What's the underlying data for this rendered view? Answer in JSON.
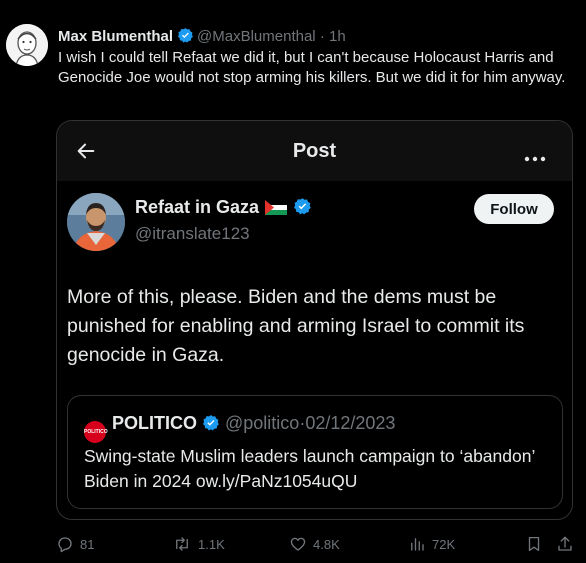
{
  "tweet": {
    "author_name": "Max Blumenthal",
    "author_handle": "@MaxBlumenthal",
    "separator": "·",
    "time": "1h",
    "text": "I wish I could tell Refaat we did it, but I can't because Holocaust Harris and Genocide Joe would not stop arming his killers. But we did it for him anyway."
  },
  "embed": {
    "header_title": "Post",
    "author_name": "Refaat in Gaza",
    "author_handle": "@itranslate123",
    "follow_label": "Follow",
    "text": "More of this, please. Biden and the dems must be punished for enabling and arming Israel to commit its genocide in Gaza.",
    "quote": {
      "logo_text": "POLITICO",
      "name": "POLITICO",
      "handle": "@politico",
      "separator": "·",
      "date": "02/12/2023",
      "text": "Swing-state Muslim leaders launch campaign to ‘abandon’ Biden in 2024 ow.ly/PaNz1054uQU"
    }
  },
  "actions": {
    "replies": "81",
    "reposts": "1.1K",
    "likes": "4.8K",
    "views": "72K"
  },
  "colors": {
    "background": "#000000",
    "text": "#e7e9ea",
    "muted": "#71767b",
    "verified": "#1d9bf0",
    "border": "#2f3336",
    "politico_red": "#d6001c"
  },
  "icons": [
    "avatar",
    "verified-icon",
    "back-arrow-icon",
    "more-icon",
    "palestine-flag-icon",
    "reply-icon",
    "repost-icon",
    "like-icon",
    "views-icon",
    "bookmark-icon",
    "share-icon"
  ]
}
